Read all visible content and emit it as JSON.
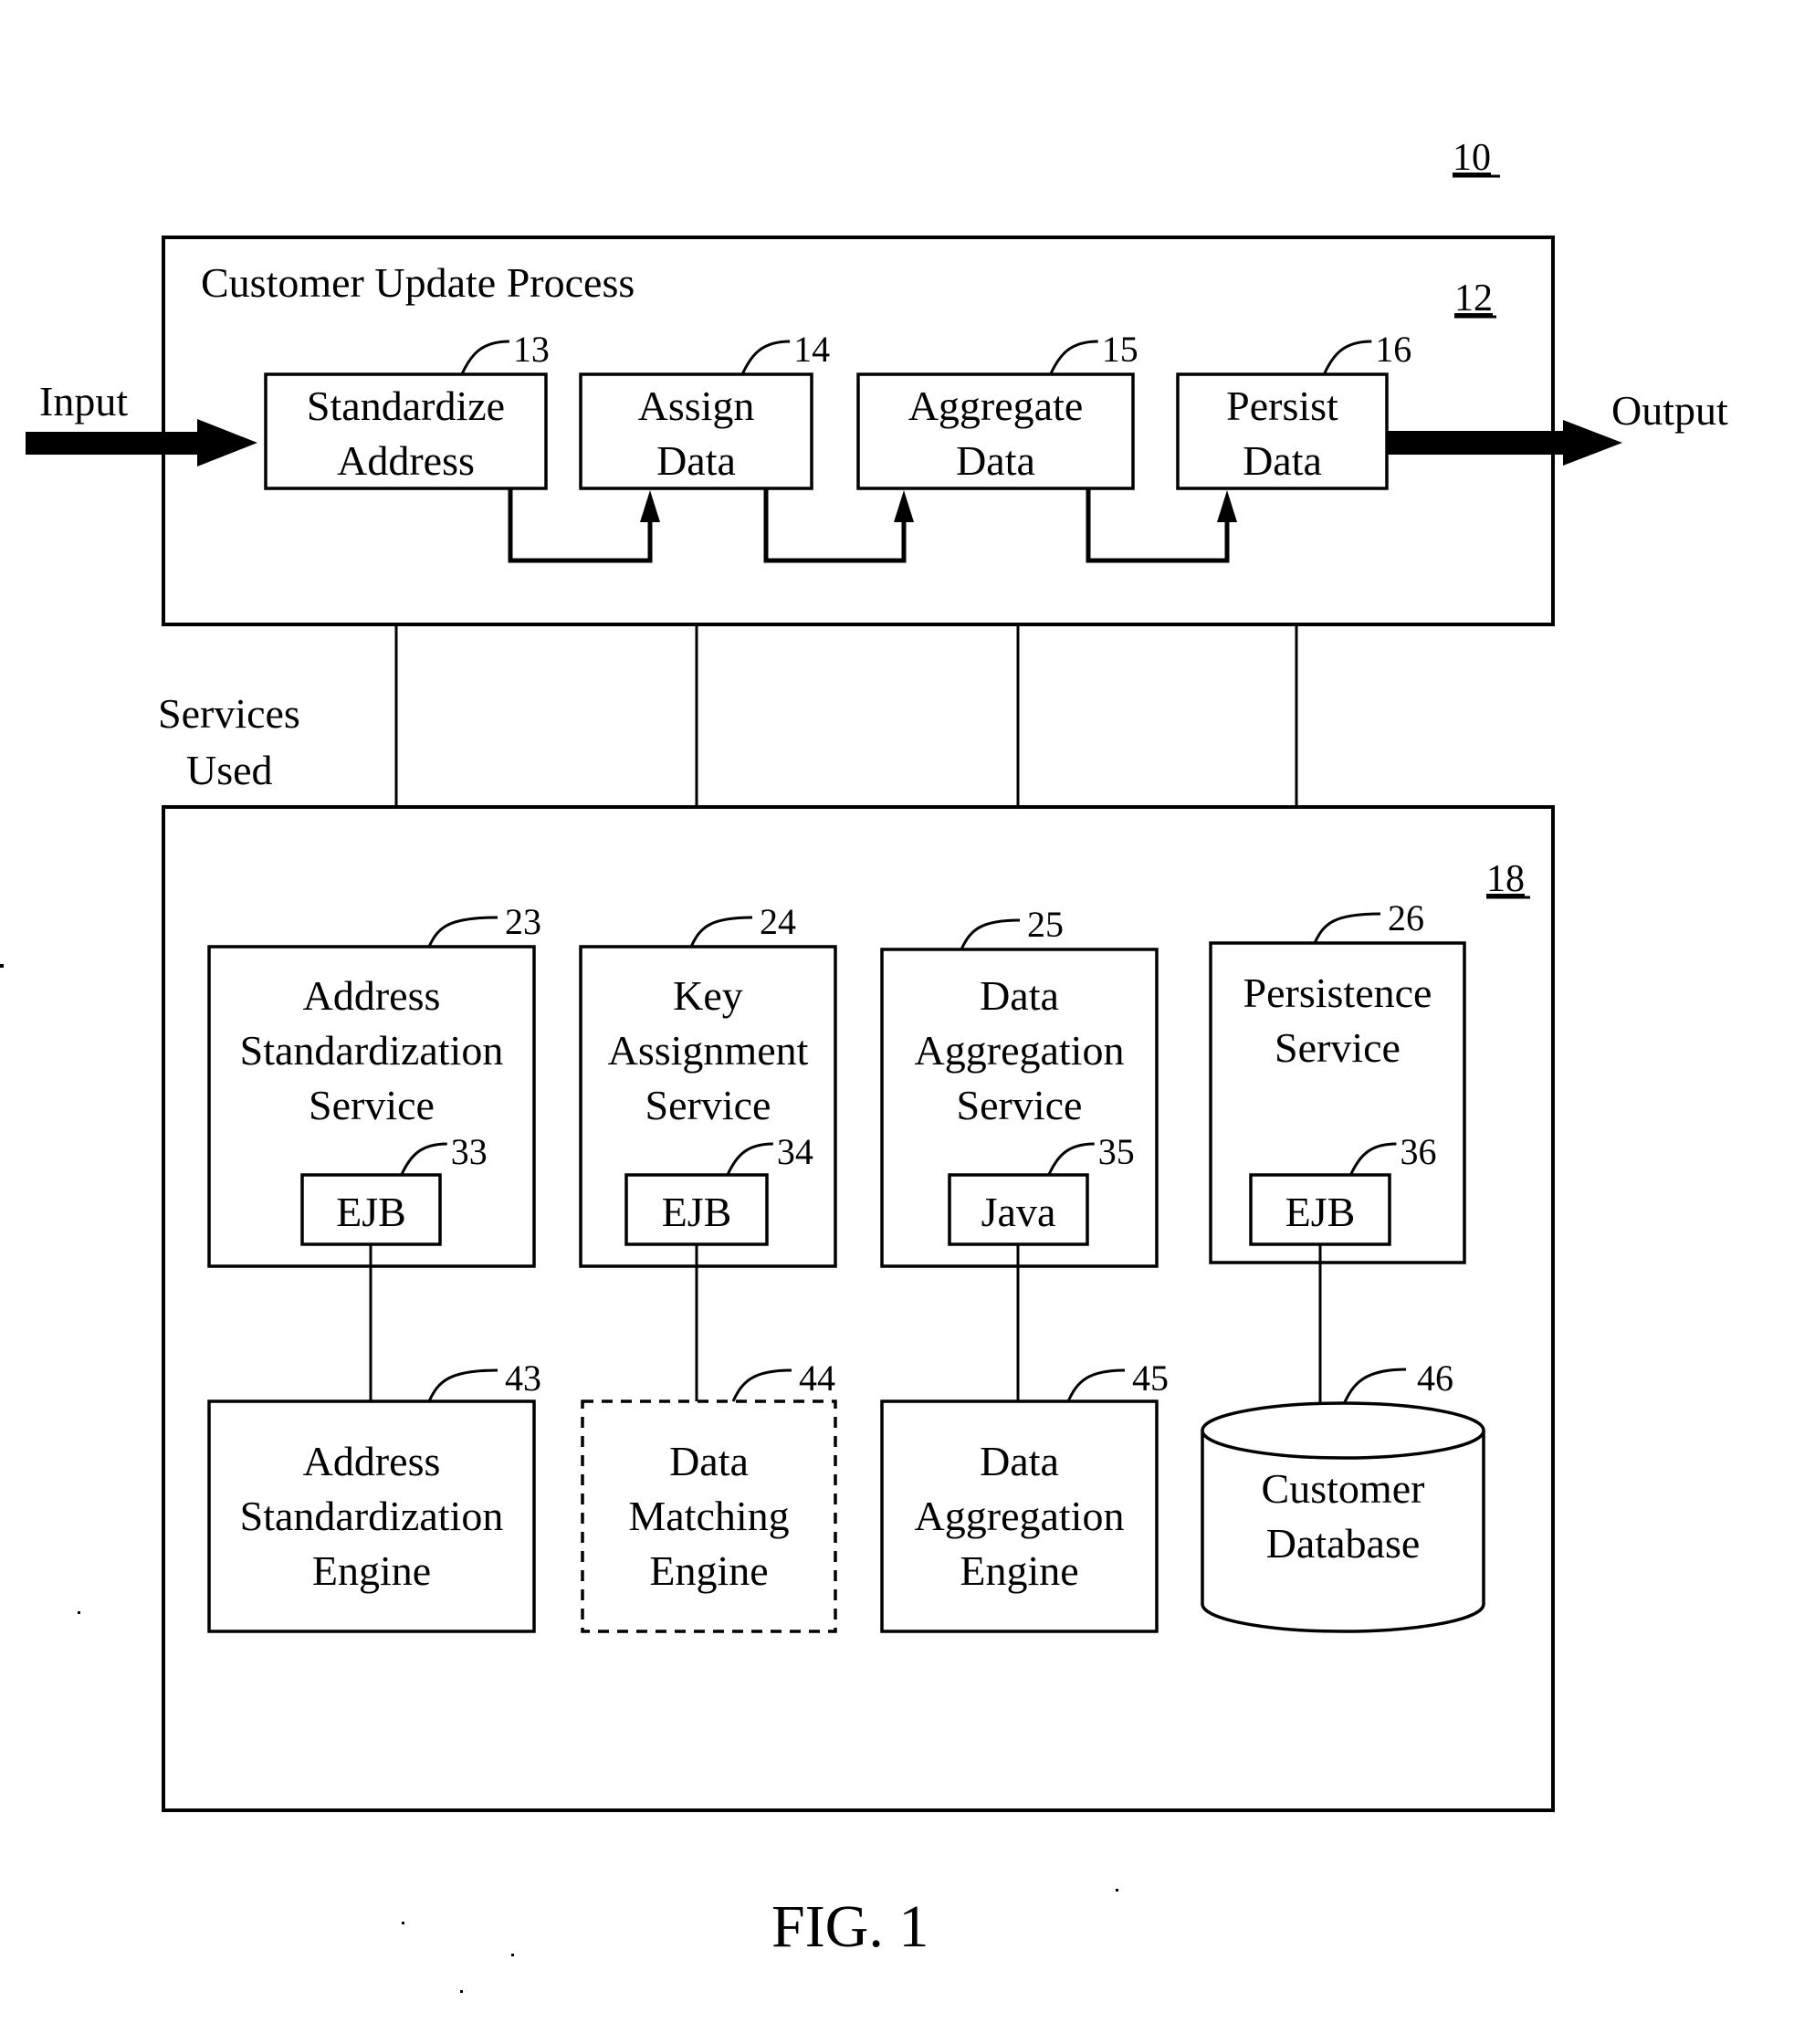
{
  "figure": {
    "caption": "FIG. 1",
    "system_ref": "10"
  },
  "process": {
    "ref": "12",
    "title": "Customer Update Process",
    "input_label": "Input",
    "output_label": "Output",
    "steps": [
      {
        "ref": "13",
        "lines": [
          "Standardize",
          "Address"
        ]
      },
      {
        "ref": "14",
        "lines": [
          "Assign",
          "Data"
        ]
      },
      {
        "ref": "15",
        "lines": [
          "Aggregate",
          "Data"
        ]
      },
      {
        "ref": "16",
        "lines": [
          "Persist",
          "Data"
        ]
      }
    ]
  },
  "services_used_label": [
    "Services",
    "Used"
  ],
  "services_layer": {
    "ref": "18",
    "services": [
      {
        "ref": "23",
        "lines": [
          "Address",
          "Standardization",
          "Service"
        ],
        "impl_ref": "33",
        "impl": "EJB"
      },
      {
        "ref": "24",
        "lines": [
          "Key",
          "Assignment",
          "Service"
        ],
        "impl_ref": "34",
        "impl": "EJB"
      },
      {
        "ref": "25",
        "lines": [
          "Data",
          "Aggregation",
          "Service"
        ],
        "impl_ref": "35",
        "impl": "Java"
      },
      {
        "ref": "26",
        "lines": [
          "Persistence",
          "Service"
        ],
        "impl_ref": "36",
        "impl": "EJB"
      }
    ],
    "backends": [
      {
        "ref": "43",
        "lines": [
          "Address",
          "Standardization",
          "Engine"
        ],
        "kind": "box",
        "optional": false
      },
      {
        "ref": "44",
        "lines": [
          "Data",
          "Matching",
          "Engine"
        ],
        "kind": "box",
        "optional": true
      },
      {
        "ref": "45",
        "lines": [
          "Data",
          "Aggregation",
          "Engine"
        ],
        "kind": "box",
        "optional": false
      },
      {
        "ref": "46",
        "lines": [
          "Customer",
          "Database"
        ],
        "kind": "database",
        "optional": false
      }
    ]
  }
}
